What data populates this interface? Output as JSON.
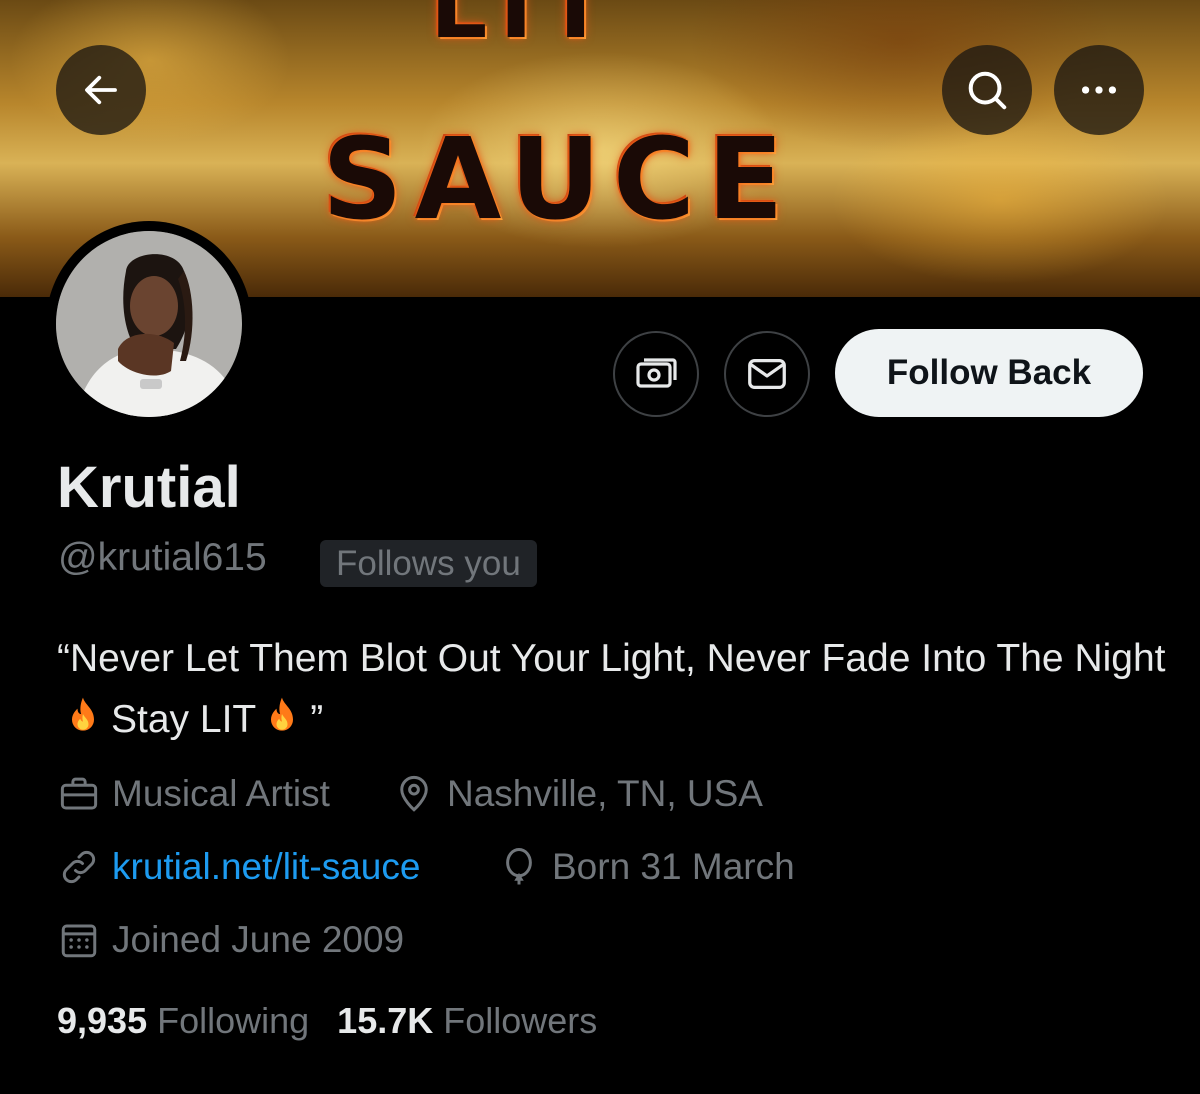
{
  "banner": {
    "text_top": "LIT",
    "text_main": "SAUCE"
  },
  "header": {
    "back_icon": "arrow-left-icon",
    "search_icon": "search-icon",
    "more_icon": "more-horizontal-icon"
  },
  "actions": {
    "tip_icon": "money-icon",
    "message_icon": "mail-icon",
    "follow_label": "Follow Back"
  },
  "profile": {
    "name": "Krutial",
    "handle": "@krutial615",
    "follows_you": "Follows you",
    "bio_part1": "“Never Let Them Blot Out Your Light, Never Fade Into The Night",
    "bio_part2": "Stay LIT",
    "bio_part3": "”",
    "category": "Musical Artist",
    "location": "Nashville, TN, USA",
    "website": "krutial.net/lit-sauce",
    "birthday": "Born 31 March",
    "joined": "Joined June 2009"
  },
  "stats": {
    "following_count": "9,935",
    "following_label": "Following",
    "followers_count": "15.7K",
    "followers_label": "Followers"
  },
  "colors": {
    "link": "#1d9bf0",
    "muted": "#71767b",
    "text": "#e7e9ea",
    "background": "#000000"
  }
}
